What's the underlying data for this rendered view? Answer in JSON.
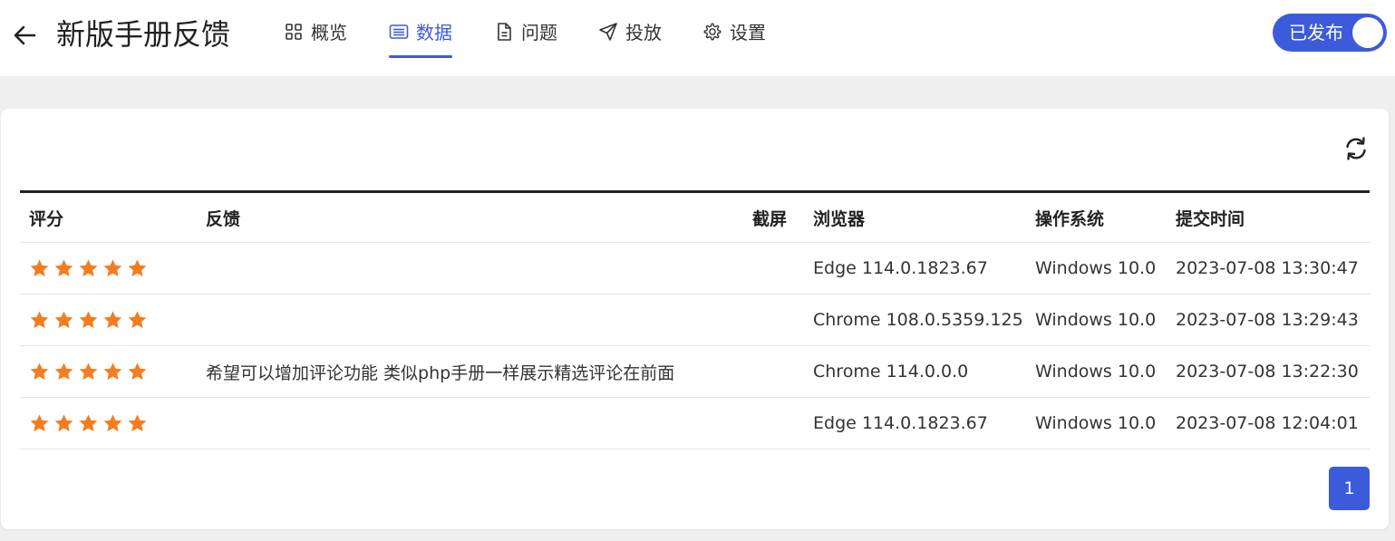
{
  "header": {
    "back_icon": "arrow-left-icon",
    "title": "新版手册反馈",
    "tabs": [
      {
        "label": "概览",
        "icon": "grid-icon",
        "active": false
      },
      {
        "label": "数据",
        "icon": "list-icon",
        "active": true
      },
      {
        "label": "问题",
        "icon": "document-icon",
        "active": false
      },
      {
        "label": "投放",
        "icon": "send-icon",
        "active": false
      },
      {
        "label": "设置",
        "icon": "gear-icon",
        "active": false
      }
    ],
    "publish_toggle": {
      "label": "已发布",
      "on": true
    }
  },
  "colors": {
    "accent": "#3c5bdb",
    "star": "#f57c1f",
    "page_bg": "#efefef"
  },
  "toolbar": {
    "refresh_icon": "refresh-icon"
  },
  "table": {
    "columns": [
      "评分",
      "反馈",
      "截屏",
      "浏览器",
      "操作系统",
      "提交时间"
    ],
    "rows": [
      {
        "rating": 5,
        "feedback": "",
        "screenshot": "",
        "browser": "Edge 114.0.1823.67",
        "os": "Windows 10.0",
        "time": "2023-07-08 13:30:47"
      },
      {
        "rating": 5,
        "feedback": "",
        "screenshot": "",
        "browser": "Chrome 108.0.5359.125",
        "os": "Windows 10.0",
        "time": "2023-07-08 13:29:43"
      },
      {
        "rating": 5,
        "feedback": "希望可以增加评论功能 类似php手册一样展示精选评论在前面",
        "screenshot": "",
        "browser": "Chrome 114.0.0.0",
        "os": "Windows 10.0",
        "time": "2023-07-08 13:22:30"
      },
      {
        "rating": 5,
        "feedback": "",
        "screenshot": "",
        "browser": "Edge 114.0.1823.67",
        "os": "Windows 10.0",
        "time": "2023-07-08 12:04:01"
      }
    ]
  },
  "pagination": {
    "current_page": "1"
  }
}
